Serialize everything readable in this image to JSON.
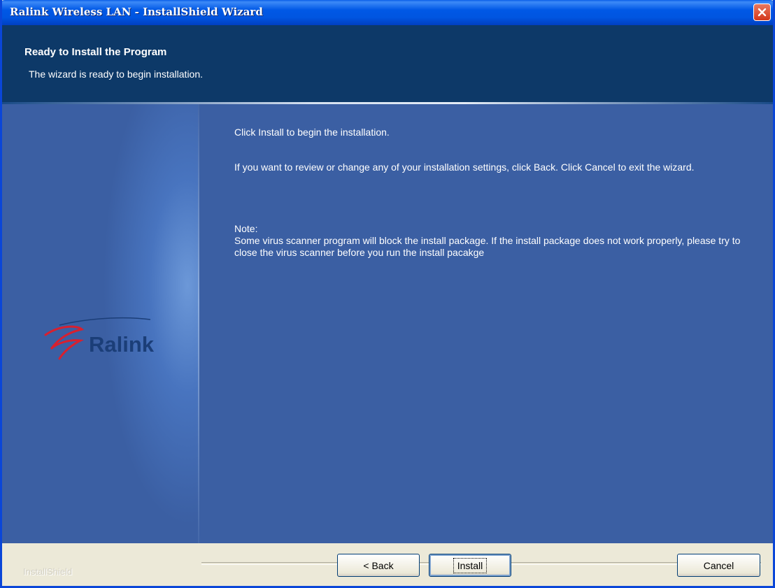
{
  "window": {
    "title": "Ralink Wireless LAN - InstallShield Wizard",
    "close_icon": "close-icon"
  },
  "header": {
    "title": "Ready to Install the Program",
    "subtitle": "The wizard is ready to begin installation."
  },
  "logo": {
    "text": "Ralink",
    "icon": "ralink-logo-swoosh"
  },
  "content": {
    "paragraph1": "Click Install to begin the installation.",
    "paragraph2": "If you want to review or change any of your installation settings, click Back. Click Cancel to exit the wizard.",
    "note_heading": "Note:",
    "note_body": "Some virus scanner program will block the install package. If the install package does not work properly, please try to close the virus scanner before you run the install pacakge"
  },
  "footer": {
    "brand": "InstallShield",
    "back_label": "< Back",
    "install_label": "Install",
    "cancel_label": "Cancel"
  },
  "colors": {
    "titlebar": "#0058e6",
    "header_bg": "#0d3968",
    "main_bg": "#3b5fa3",
    "footer_bg": "#ece9d8",
    "logo_red": "#d8202f",
    "logo_text": "#1b3e78"
  }
}
